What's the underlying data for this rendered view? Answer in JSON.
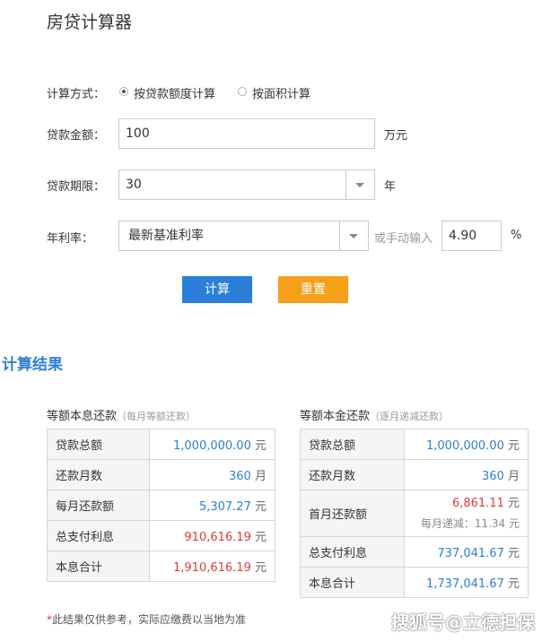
{
  "page_title": "房贷计算器",
  "form": {
    "method_label": "计算方式：",
    "method_options": [
      "按贷款额度计算",
      "按面积计算"
    ],
    "amount_label": "贷款金额：",
    "amount_value": "100",
    "amount_unit": "万元",
    "term_label": "贷款期限：",
    "term_value": "30",
    "term_unit": "年",
    "rate_label": "年利率：",
    "rate_select": "最新基准利率",
    "manual_label": "或手动输入",
    "rate_value": "4.90",
    "rate_unit": "%",
    "calc_button": "计算",
    "reset_button": "重置"
  },
  "results": {
    "heading": "计算结果",
    "equal_payment": {
      "title": "等额本息还款",
      "hint": "（每月等额还款）",
      "rows": [
        {
          "label": "贷款总额",
          "value": "1,000,000.00",
          "unit": "元"
        },
        {
          "label": "还款月数",
          "value": "360",
          "unit": "月"
        },
        {
          "label": "每月还款额",
          "value": "5,307.27",
          "unit": "元"
        },
        {
          "label": "总支付利息",
          "value": "910,616.19",
          "unit": "元"
        },
        {
          "label": "本息合计",
          "value": "1,910,616.19",
          "unit": "元"
        }
      ]
    },
    "equal_principal": {
      "title": "等额本金还款",
      "hint": "（逐月递减还款）",
      "rows": [
        {
          "label": "贷款总额",
          "value": "1,000,000.00",
          "unit": "元"
        },
        {
          "label": "还款月数",
          "value": "360",
          "unit": "月"
        },
        {
          "label": "首月还款额",
          "value": "6,861.11",
          "unit": "元",
          "extra": "每月递减：11.34 元"
        },
        {
          "label": "总支付利息",
          "value": "737,041.67",
          "unit": "元"
        },
        {
          "label": "本息合计",
          "value": "1,737,041.67",
          "unit": "元"
        }
      ]
    },
    "note_star": "*",
    "note": "此结果仅供参考，实际应缴费以当地为准"
  },
  "watermark": "搜狐号@立德担保",
  "colors": {
    "accent_blue": "#2b7fd9",
    "accent_orange": "#f6a01a",
    "value_red": "#e03a3a"
  }
}
